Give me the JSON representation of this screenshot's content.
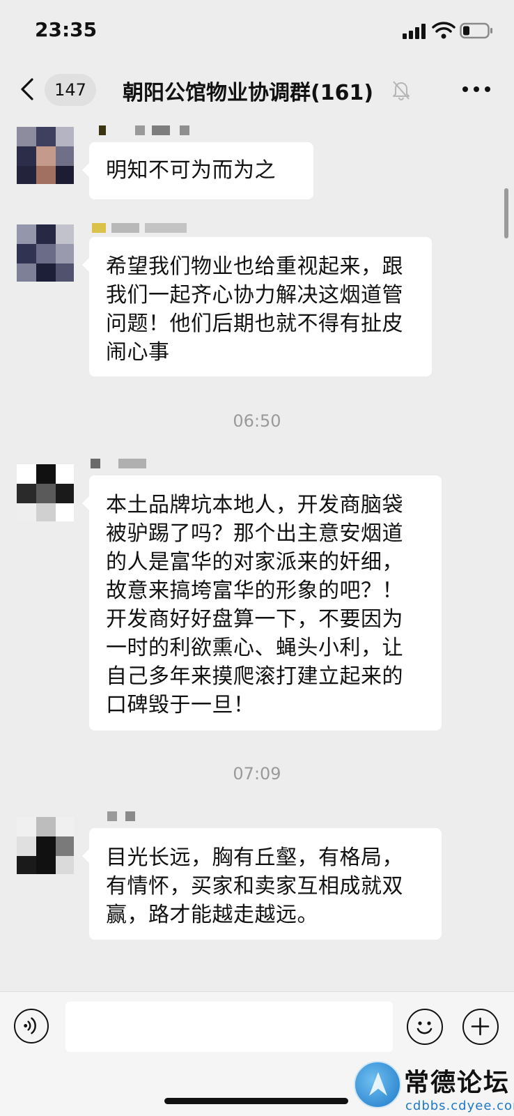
{
  "status_bar": {
    "time": "23:35"
  },
  "header": {
    "unread_count": "147",
    "title": "朝阳公馆物业协调群(161)"
  },
  "messages": [
    {
      "text": "明知不可为而为之"
    },
    {
      "text": "希望我们物业也给重视起来，跟我们一起齐心协力解决这烟道管问题！他们后期也就不得有扯皮闹心事"
    },
    {
      "text": "本土品牌坑本地人，开发商脑袋被驴踢了吗？那个出主意安烟道的人是富华的对家派来的奸细，故意来搞垮富华的形象的吧？！开发商好好盘算一下，不要因为一时的利欲熏心、蝇头小利，让自己多年来摸爬滚打建立起来的口碑毁于一旦！"
    },
    {
      "text": "目光长远，胸有丘壑，有格局，有情怀，买家和卖家互相成就双赢，路才能越走越远。"
    }
  ],
  "time_dividers": [
    "06:50",
    "07:09"
  ],
  "input_bar": {
    "placeholder": ""
  },
  "watermark": {
    "name": "常德论坛",
    "url": "cdbbs.cdyee.com"
  },
  "icons": [
    "back-icon",
    "signal-icon",
    "wifi-icon",
    "battery-icon",
    "mute-icon",
    "more-icon",
    "voice-icon",
    "emoji-icon",
    "plus-icon"
  ]
}
